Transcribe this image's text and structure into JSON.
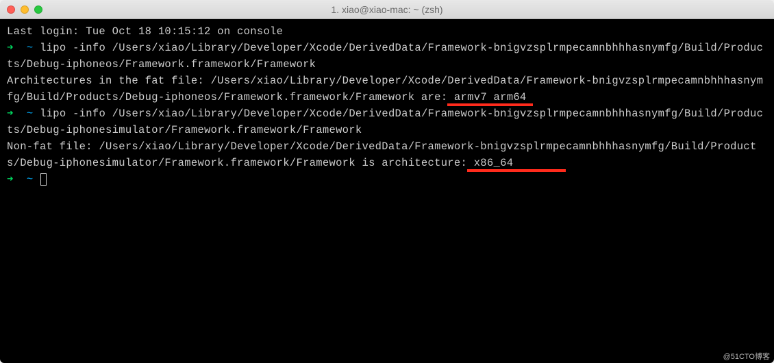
{
  "window": {
    "title": "1. xiao@xiao-mac: ~ (zsh)"
  },
  "terminal": {
    "last_login": "Last login: Tue Oct 18 10:15:12 on console",
    "prompt_arrow": "➜",
    "prompt_tilde": "~",
    "cmd1": "lipo -info /Users/xiao/Library/Developer/Xcode/DerivedData/Framework-bnigvzsplrmpecamnbhhhasnymfg/Build/Products/Debug-iphoneos/Framework.framework/Framework",
    "out1_pre": "Architectures in the fat file: /Users/xiao/Library/Developer/Xcode/DerivedData/Framework-bnigvzsplrmpecamnbhhhasnymfg/Build/Products/Debug-iphoneos/Framework.framework/Framework are:",
    "out1_arch": " armv7 arm64 ",
    "cmd2": "lipo -info /Users/xiao/Library/Developer/Xcode/DerivedData/Framework-bnigvzsplrmpecamnbhhhasnymfg/Build/Products/Debug-iphonesimulator/Framework.framework/Framework",
    "out2_pre": "Non-fat file: /Users/xiao/Library/Developer/Xcode/DerivedData/Framework-bnigvzsplrmpecamnbhhhasnymfg/Build/Products/Debug-iphonesimulator/Framework.framework/Framework is architecture:",
    "out2_arch": " x86_64        "
  },
  "watermark": "@51CTO博客"
}
